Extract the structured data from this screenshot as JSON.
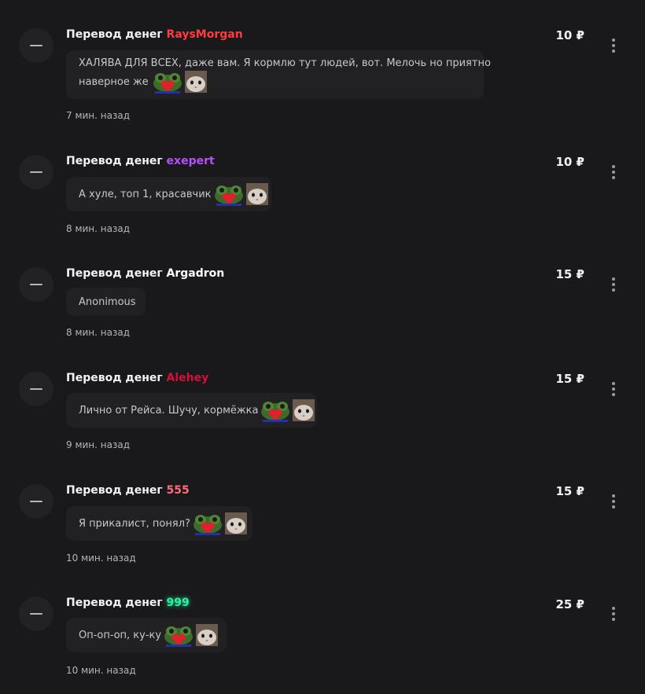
{
  "colors": {
    "background": "#19191b",
    "bubble": "#212124",
    "user_raysmorgan": "#ff3b3b",
    "user_exepert": "#b84dff",
    "user_argadron": "#ffffff",
    "user_alehey": "#d4103a",
    "user_555": "#ff6b7a",
    "user_999": "#2cf0a0"
  },
  "currency": "₽",
  "transactions": [
    {
      "prefix": "Перевод денег",
      "user": "RaysMorgan",
      "amount": "10 ₽",
      "message_line1": "ХАЛЯВА ДЛЯ ВСЕХ, даже вам. Я кормлю тут людей, вот. Мелочь но приятно",
      "message_line2": "наверное же",
      "emotes": [
        "frog-heart-emote",
        "cat-emote"
      ],
      "time": "7 мин. назад"
    },
    {
      "prefix": "Перевод денег",
      "user": "exepert",
      "amount": "10 ₽",
      "message_line1": "А хуле, топ 1, красавчик",
      "emotes": [
        "frog-heart-emote",
        "cat-emote"
      ],
      "time": "8 мин. назад"
    },
    {
      "prefix": "Перевод денег",
      "user": "Argadron",
      "amount": "15 ₽",
      "message_line1": "Anonimous",
      "emotes": [],
      "time": "8 мин. назад"
    },
    {
      "prefix": "Перевод денег",
      "user": "Alehey",
      "amount": "15 ₽",
      "message_line1": "Лично от Рейса. Шучу, кормёжка",
      "emotes": [
        "frog-heart-emote",
        "cat-emote"
      ],
      "time": "9 мин. назад"
    },
    {
      "prefix": "Перевод денег",
      "user": "555",
      "amount": "15 ₽",
      "message_line1": "Я прикалист, понял?",
      "emotes": [
        "frog-heart-emote",
        "cat-emote"
      ],
      "time": "10 мин. назад"
    },
    {
      "prefix": "Перевод денег",
      "user": "999",
      "amount": "25 ₽",
      "message_line1": "Оп-оп-оп, ку-ку",
      "emotes": [
        "frog-heart-emote",
        "cat-emote"
      ],
      "time": "10 мин. назад"
    }
  ]
}
